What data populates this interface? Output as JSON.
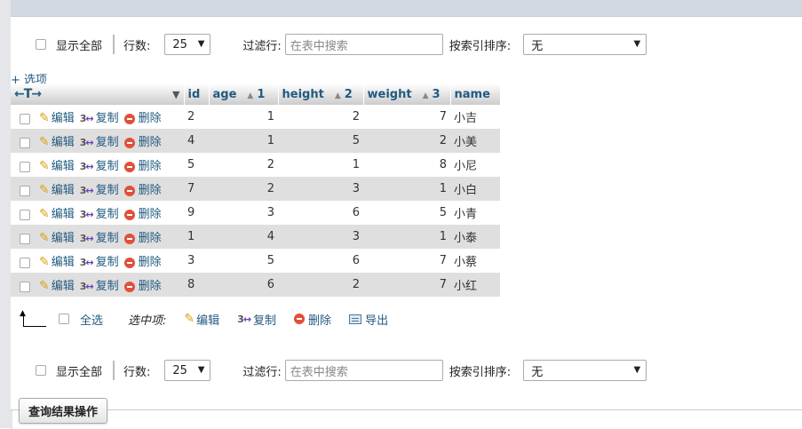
{
  "filter_top": {
    "show_all": "显示全部",
    "rows_label": "行数:",
    "rows_value": "25",
    "filter_label": "过滤行:",
    "filter_placeholder": "在表中搜索",
    "sort_label": "按索引排序:",
    "sort_value": "无"
  },
  "options_link": "+ 选项",
  "table": {
    "head_arrows": "←T→",
    "columns": [
      {
        "label": "id",
        "sort_index": ""
      },
      {
        "label": "age",
        "sort_index": "1"
      },
      {
        "label": "height",
        "sort_index": "2"
      },
      {
        "label": "weight",
        "sort_index": "3"
      },
      {
        "label": "name",
        "sort_index": ""
      }
    ],
    "actions": {
      "edit": "编辑",
      "copy": "复制",
      "delete": "删除"
    },
    "rows": [
      {
        "id": "2",
        "age": "1",
        "height": "2",
        "weight": "7",
        "name": "小吉"
      },
      {
        "id": "4",
        "age": "1",
        "height": "5",
        "weight": "2",
        "name": "小美"
      },
      {
        "id": "5",
        "age": "2",
        "height": "1",
        "weight": "8",
        "name": "小尼"
      },
      {
        "id": "7",
        "age": "2",
        "height": "3",
        "weight": "1",
        "name": "小白"
      },
      {
        "id": "9",
        "age": "3",
        "height": "6",
        "weight": "5",
        "name": "小青"
      },
      {
        "id": "1",
        "age": "4",
        "height": "3",
        "weight": "1",
        "name": "小泰"
      },
      {
        "id": "3",
        "age": "5",
        "height": "6",
        "weight": "7",
        "name": "小蔡"
      },
      {
        "id": "8",
        "age": "6",
        "height": "2",
        "weight": "7",
        "name": "小红"
      }
    ]
  },
  "bottom_actions": {
    "check_all": "全选",
    "with_selected": "选中项:",
    "edit": "编辑",
    "copy": "复制",
    "delete": "删除",
    "export": "导出"
  },
  "filter_bottom": {
    "show_all": "显示全部",
    "rows_label": "行数:",
    "rows_value": "25",
    "filter_label": "过滤行:",
    "filter_placeholder": "在表中搜索",
    "sort_label": "按索引排序:",
    "sort_value": "无"
  },
  "query_ops_label": "查询结果操作",
  "colors": {
    "link": "#235a81",
    "row_even": "#dfdfdf",
    "topbar": "#d3d9e0"
  }
}
